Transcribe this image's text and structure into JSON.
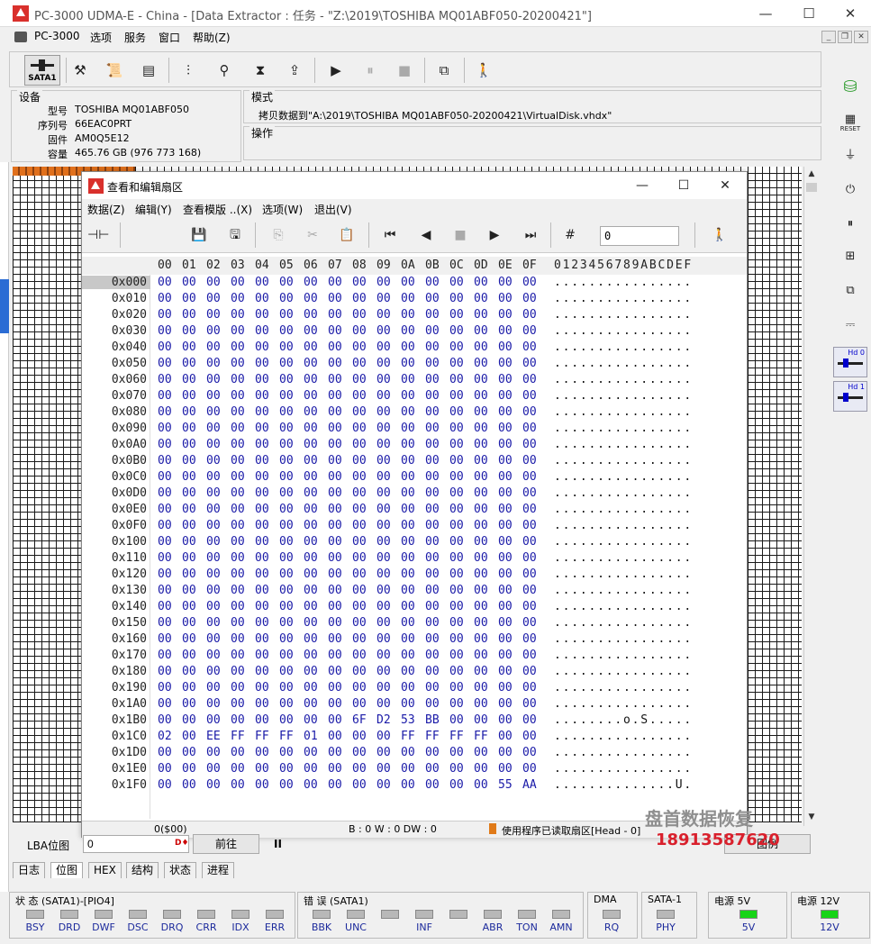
{
  "window": {
    "title": "PC-3000 UDMA-E - China - [Data Extractor : 任务 - \"Z:\\2019\\TOSHIBA MQ01ABF050-20200421\"]",
    "minimize": "—",
    "maximize": "☐",
    "close": "✕"
  },
  "menu": {
    "app": "PC-3000",
    "items": [
      "选项",
      "服务",
      "窗口",
      "帮助(Z)"
    ]
  },
  "toolbar": {
    "sata_label": "SATA1"
  },
  "device": {
    "group": "设备",
    "rows": [
      {
        "label": "型号",
        "value": "TOSHIBA MQ01ABF050"
      },
      {
        "label": "序列号",
        "value": "66EAC0PRT"
      },
      {
        "label": "固件",
        "value": "AM0Q5E12"
      },
      {
        "label": "容量",
        "value": "465.76 GB (976 773 168)"
      }
    ]
  },
  "mode": {
    "group": "模式",
    "text": "拷贝数据到\"A:\\2019\\TOSHIBA MQ01ABF050-20200421\\VirtualDisk.vhdx\""
  },
  "operation": {
    "group": "操作"
  },
  "right_toolbar": {
    "reset_label": "RESET",
    "hd0": "Hd 0",
    "hd1": "Hd 1"
  },
  "sector_dialog": {
    "title": "查看和编辑扇区",
    "menu": [
      "数据(Z)",
      "编辑(Y)",
      "查看模版 ..(X)",
      "选项(W)",
      "退出(V)"
    ],
    "lba_value": "0",
    "columns": [
      "00",
      "01",
      "02",
      "03",
      "04",
      "05",
      "06",
      "07",
      "08",
      "09",
      "0A",
      "0B",
      "0C",
      "0D",
      "0E",
      "0F"
    ],
    "ascii_header": "0123456789ABCDEF",
    "rows": [
      {
        "off": "0x000",
        "bytes": [
          "00",
          "00",
          "00",
          "00",
          "00",
          "00",
          "00",
          "00",
          "00",
          "00",
          "00",
          "00",
          "00",
          "00",
          "00",
          "00"
        ],
        "ascii": "................"
      },
      {
        "off": "0x010",
        "bytes": [
          "00",
          "00",
          "00",
          "00",
          "00",
          "00",
          "00",
          "00",
          "00",
          "00",
          "00",
          "00",
          "00",
          "00",
          "00",
          "00"
        ],
        "ascii": "................"
      },
      {
        "off": "0x020",
        "bytes": [
          "00",
          "00",
          "00",
          "00",
          "00",
          "00",
          "00",
          "00",
          "00",
          "00",
          "00",
          "00",
          "00",
          "00",
          "00",
          "00"
        ],
        "ascii": "................"
      },
      {
        "off": "0x030",
        "bytes": [
          "00",
          "00",
          "00",
          "00",
          "00",
          "00",
          "00",
          "00",
          "00",
          "00",
          "00",
          "00",
          "00",
          "00",
          "00",
          "00"
        ],
        "ascii": "................"
      },
      {
        "off": "0x040",
        "bytes": [
          "00",
          "00",
          "00",
          "00",
          "00",
          "00",
          "00",
          "00",
          "00",
          "00",
          "00",
          "00",
          "00",
          "00",
          "00",
          "00"
        ],
        "ascii": "................"
      },
      {
        "off": "0x050",
        "bytes": [
          "00",
          "00",
          "00",
          "00",
          "00",
          "00",
          "00",
          "00",
          "00",
          "00",
          "00",
          "00",
          "00",
          "00",
          "00",
          "00"
        ],
        "ascii": "................"
      },
      {
        "off": "0x060",
        "bytes": [
          "00",
          "00",
          "00",
          "00",
          "00",
          "00",
          "00",
          "00",
          "00",
          "00",
          "00",
          "00",
          "00",
          "00",
          "00",
          "00"
        ],
        "ascii": "................"
      },
      {
        "off": "0x070",
        "bytes": [
          "00",
          "00",
          "00",
          "00",
          "00",
          "00",
          "00",
          "00",
          "00",
          "00",
          "00",
          "00",
          "00",
          "00",
          "00",
          "00"
        ],
        "ascii": "................"
      },
      {
        "off": "0x080",
        "bytes": [
          "00",
          "00",
          "00",
          "00",
          "00",
          "00",
          "00",
          "00",
          "00",
          "00",
          "00",
          "00",
          "00",
          "00",
          "00",
          "00"
        ],
        "ascii": "................"
      },
      {
        "off": "0x090",
        "bytes": [
          "00",
          "00",
          "00",
          "00",
          "00",
          "00",
          "00",
          "00",
          "00",
          "00",
          "00",
          "00",
          "00",
          "00",
          "00",
          "00"
        ],
        "ascii": "................"
      },
      {
        "off": "0x0A0",
        "bytes": [
          "00",
          "00",
          "00",
          "00",
          "00",
          "00",
          "00",
          "00",
          "00",
          "00",
          "00",
          "00",
          "00",
          "00",
          "00",
          "00"
        ],
        "ascii": "................"
      },
      {
        "off": "0x0B0",
        "bytes": [
          "00",
          "00",
          "00",
          "00",
          "00",
          "00",
          "00",
          "00",
          "00",
          "00",
          "00",
          "00",
          "00",
          "00",
          "00",
          "00"
        ],
        "ascii": "................"
      },
      {
        "off": "0x0C0",
        "bytes": [
          "00",
          "00",
          "00",
          "00",
          "00",
          "00",
          "00",
          "00",
          "00",
          "00",
          "00",
          "00",
          "00",
          "00",
          "00",
          "00"
        ],
        "ascii": "................"
      },
      {
        "off": "0x0D0",
        "bytes": [
          "00",
          "00",
          "00",
          "00",
          "00",
          "00",
          "00",
          "00",
          "00",
          "00",
          "00",
          "00",
          "00",
          "00",
          "00",
          "00"
        ],
        "ascii": "................"
      },
      {
        "off": "0x0E0",
        "bytes": [
          "00",
          "00",
          "00",
          "00",
          "00",
          "00",
          "00",
          "00",
          "00",
          "00",
          "00",
          "00",
          "00",
          "00",
          "00",
          "00"
        ],
        "ascii": "................"
      },
      {
        "off": "0x0F0",
        "bytes": [
          "00",
          "00",
          "00",
          "00",
          "00",
          "00",
          "00",
          "00",
          "00",
          "00",
          "00",
          "00",
          "00",
          "00",
          "00",
          "00"
        ],
        "ascii": "................"
      },
      {
        "off": "0x100",
        "bytes": [
          "00",
          "00",
          "00",
          "00",
          "00",
          "00",
          "00",
          "00",
          "00",
          "00",
          "00",
          "00",
          "00",
          "00",
          "00",
          "00"
        ],
        "ascii": "................"
      },
      {
        "off": "0x110",
        "bytes": [
          "00",
          "00",
          "00",
          "00",
          "00",
          "00",
          "00",
          "00",
          "00",
          "00",
          "00",
          "00",
          "00",
          "00",
          "00",
          "00"
        ],
        "ascii": "................"
      },
      {
        "off": "0x120",
        "bytes": [
          "00",
          "00",
          "00",
          "00",
          "00",
          "00",
          "00",
          "00",
          "00",
          "00",
          "00",
          "00",
          "00",
          "00",
          "00",
          "00"
        ],
        "ascii": "................"
      },
      {
        "off": "0x130",
        "bytes": [
          "00",
          "00",
          "00",
          "00",
          "00",
          "00",
          "00",
          "00",
          "00",
          "00",
          "00",
          "00",
          "00",
          "00",
          "00",
          "00"
        ],
        "ascii": "................"
      },
      {
        "off": "0x140",
        "bytes": [
          "00",
          "00",
          "00",
          "00",
          "00",
          "00",
          "00",
          "00",
          "00",
          "00",
          "00",
          "00",
          "00",
          "00",
          "00",
          "00"
        ],
        "ascii": "................"
      },
      {
        "off": "0x150",
        "bytes": [
          "00",
          "00",
          "00",
          "00",
          "00",
          "00",
          "00",
          "00",
          "00",
          "00",
          "00",
          "00",
          "00",
          "00",
          "00",
          "00"
        ],
        "ascii": "................"
      },
      {
        "off": "0x160",
        "bytes": [
          "00",
          "00",
          "00",
          "00",
          "00",
          "00",
          "00",
          "00",
          "00",
          "00",
          "00",
          "00",
          "00",
          "00",
          "00",
          "00"
        ],
        "ascii": "................"
      },
      {
        "off": "0x170",
        "bytes": [
          "00",
          "00",
          "00",
          "00",
          "00",
          "00",
          "00",
          "00",
          "00",
          "00",
          "00",
          "00",
          "00",
          "00",
          "00",
          "00"
        ],
        "ascii": "................"
      },
      {
        "off": "0x180",
        "bytes": [
          "00",
          "00",
          "00",
          "00",
          "00",
          "00",
          "00",
          "00",
          "00",
          "00",
          "00",
          "00",
          "00",
          "00",
          "00",
          "00"
        ],
        "ascii": "................"
      },
      {
        "off": "0x190",
        "bytes": [
          "00",
          "00",
          "00",
          "00",
          "00",
          "00",
          "00",
          "00",
          "00",
          "00",
          "00",
          "00",
          "00",
          "00",
          "00",
          "00"
        ],
        "ascii": "................"
      },
      {
        "off": "0x1A0",
        "bytes": [
          "00",
          "00",
          "00",
          "00",
          "00",
          "00",
          "00",
          "00",
          "00",
          "00",
          "00",
          "00",
          "00",
          "00",
          "00",
          "00"
        ],
        "ascii": "................"
      },
      {
        "off": "0x1B0",
        "bytes": [
          "00",
          "00",
          "00",
          "00",
          "00",
          "00",
          "00",
          "00",
          "6F",
          "D2",
          "53",
          "BB",
          "00",
          "00",
          "00",
          "00"
        ],
        "ascii": "........o.S....."
      },
      {
        "off": "0x1C0",
        "bytes": [
          "02",
          "00",
          "EE",
          "FF",
          "FF",
          "FF",
          "01",
          "00",
          "00",
          "00",
          "FF",
          "FF",
          "FF",
          "FF",
          "00",
          "00"
        ],
        "ascii": "................"
      },
      {
        "off": "0x1D0",
        "bytes": [
          "00",
          "00",
          "00",
          "00",
          "00",
          "00",
          "00",
          "00",
          "00",
          "00",
          "00",
          "00",
          "00",
          "00",
          "00",
          "00"
        ],
        "ascii": "................"
      },
      {
        "off": "0x1E0",
        "bytes": [
          "00",
          "00",
          "00",
          "00",
          "00",
          "00",
          "00",
          "00",
          "00",
          "00",
          "00",
          "00",
          "00",
          "00",
          "00",
          "00"
        ],
        "ascii": "................"
      },
      {
        "off": "0x1F0",
        "bytes": [
          "00",
          "00",
          "00",
          "00",
          "00",
          "00",
          "00",
          "00",
          "00",
          "00",
          "00",
          "00",
          "00",
          "00",
          "55",
          "AA"
        ],
        "ascii": "..............U."
      }
    ],
    "status": {
      "left": "0($00)",
      "mid": "B : 0 W : 0 DW : 0",
      "right": "使用程序已读取扇区[Head - 0]"
    }
  },
  "lba_bar": {
    "label": "LBA位图",
    "value": "0",
    "go_button": "前往",
    "pause": "II",
    "right_button": "图例"
  },
  "tabs": [
    "日志",
    "位图",
    "HEX",
    "结构",
    "状态",
    "进程"
  ],
  "status_panel": {
    "state": {
      "title": "状 态 (SATA1)-[PIO4]",
      "leds": [
        "BSY",
        "DRD",
        "DWF",
        "DSC",
        "DRQ",
        "CRR",
        "IDX",
        "ERR"
      ]
    },
    "errors": {
      "title": "错 误 (SATA1)",
      "leds": [
        "BBK",
        "UNC",
        "",
        "INF",
        "",
        "ABR",
        "TON",
        "AMN"
      ]
    },
    "dma": {
      "title": "DMA",
      "leds": [
        "RQ"
      ]
    },
    "sata": {
      "title": "SATA-1",
      "leds": [
        "PHY"
      ]
    },
    "p5": {
      "title": "电源 5V",
      "leds": [
        "5V"
      ]
    },
    "p12": {
      "title": "电源 12V",
      "leds": [
        "12V"
      ]
    },
    "on_color": "#17d417"
  },
  "overlay": {
    "watermark": "盘首数据恢复",
    "phone": "18913587620"
  }
}
